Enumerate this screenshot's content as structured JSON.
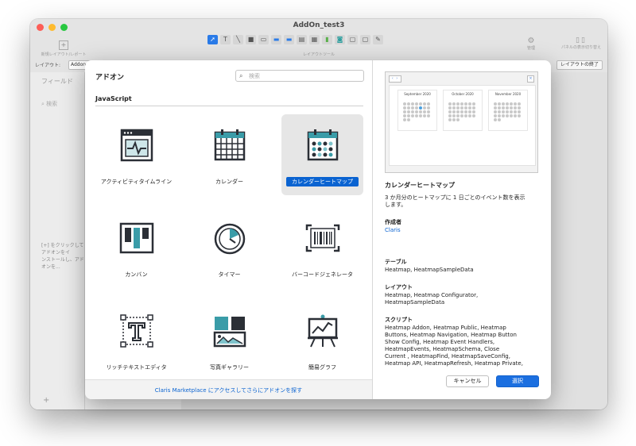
{
  "window": {
    "title": "AddOn_test3",
    "toolbar": {
      "new_layout_label": "新規レイアウト/レポート",
      "layout_tools_label": "レイアウトツール",
      "manage_label": "管理",
      "panels_label": "パネルの表示切り替え"
    },
    "layout_bar": {
      "label": "レイアウト:",
      "selected": "Addon",
      "exit_button": "レイアウトの終了"
    },
    "sidebar": {
      "tab": "フィールド",
      "search_placeholder": "検索",
      "hint_line1": "[+] をクリックしてアドオンをイ",
      "hint_line2": "ンストールし、アドオンを...",
      "add": "+"
    }
  },
  "dialog": {
    "title": "アドオン",
    "search_placeholder": "検索",
    "section": "JavaScript",
    "addons": [
      {
        "label": "アクティビティタイムライン",
        "icon": "activity-timeline-icon",
        "selected": false
      },
      {
        "label": "カレンダー",
        "icon": "calendar-icon",
        "selected": false
      },
      {
        "label": "カレンダーヒートマップ",
        "icon": "calendar-heatmap-icon",
        "selected": true
      },
      {
        "label": "カンバン",
        "icon": "kanban-icon",
        "selected": false
      },
      {
        "label": "タイマー",
        "icon": "timer-icon",
        "selected": false
      },
      {
        "label": "バーコードジェネレータ",
        "icon": "barcode-icon",
        "selected": false
      },
      {
        "label": "リッチテキストエディタ",
        "icon": "rich-text-icon",
        "selected": false
      },
      {
        "label": "写真ギャラリー",
        "icon": "photo-gallery-icon",
        "selected": false
      },
      {
        "label": "簡易グラフ",
        "icon": "simple-chart-icon",
        "selected": false
      }
    ],
    "footer_link": "Claris Marketplace にアクセスしてさらにアドオンを探す",
    "preview": {
      "nav": "‹ ›",
      "close": "×",
      "months": [
        "September 2020",
        "October 2020",
        "November 2020"
      ]
    },
    "details": {
      "name": "カレンダーヒートマップ",
      "description_line1": "3 か月分のヒートマップに 1 日ごとのイベント数を表示",
      "description_line2": "します。",
      "author_heading": "作成者",
      "author": "Claris",
      "tables_heading": "テーブル",
      "tables": "Heatmap, HeatmapSampleData",
      "layouts_heading": "レイアウト",
      "layouts_line1": "Heatmap, Heatmap Configurator,",
      "layouts_line2": "HeatmapSampleData",
      "scripts_heading": "スクリプト",
      "scripts_line1": "Heatmap Addon, Heatmap Public, Heatmap",
      "scripts_line2": "Buttons, Heatmap Navigation, Heatmap Button",
      "scripts_line3": "Show Config, Heatmap Event Handlers,",
      "scripts_line4": "HeatmapEvents, HeatmapSchema, Close",
      "scripts_line5": "Current , HeatmapFind, HeatmapSaveConfig,",
      "scripts_line6": "Heatmap API, HeatmapRefresh, Heatmap Private,"
    },
    "buttons": {
      "cancel": "キャンセル",
      "select": "選択"
    }
  },
  "colors": {
    "accent": "#1b6fe0",
    "icon_dark": "#2b2f36",
    "icon_teal": "#3a9ca8",
    "icon_blue": "#2f7fc8"
  }
}
